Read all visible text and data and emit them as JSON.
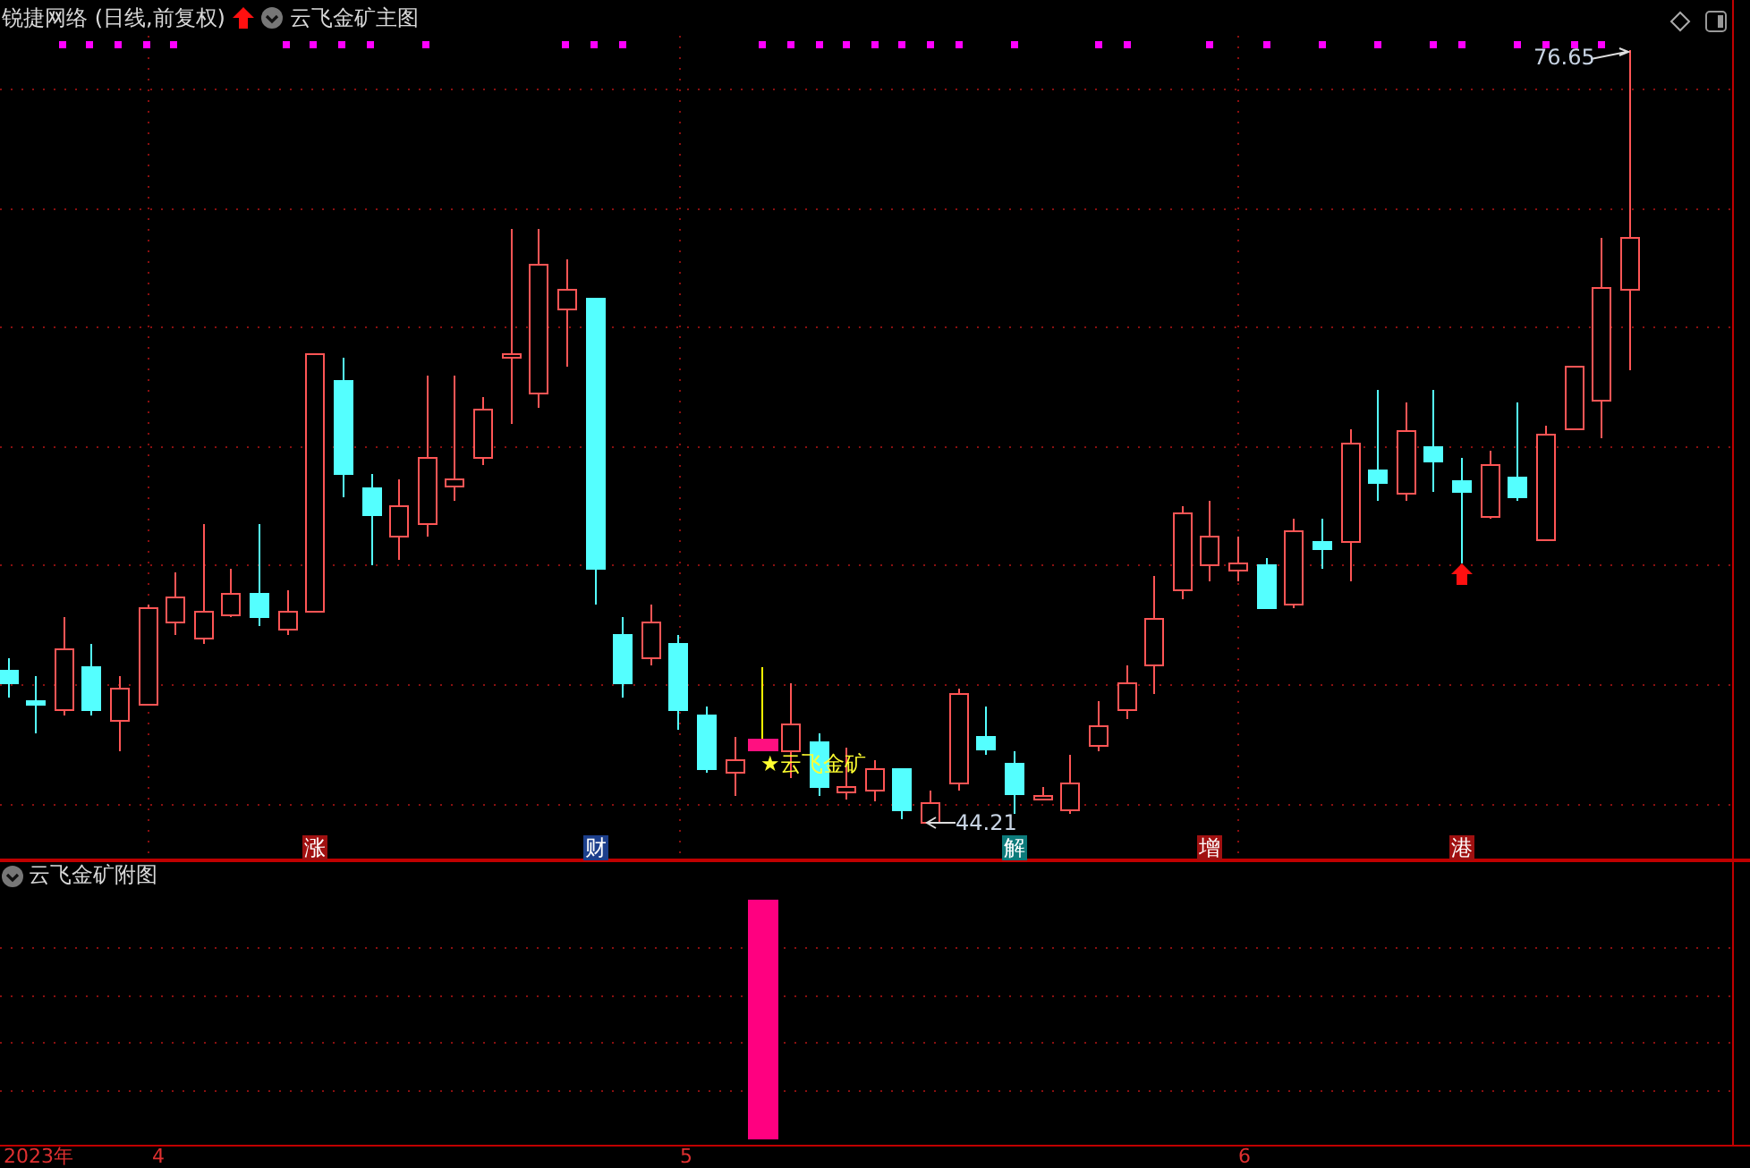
{
  "header": {
    "security": "锐捷网络 (日线,前复权)",
    "indicator": "云飞金矿主图"
  },
  "main_chart": {
    "high_label": "76.65",
    "low_label": "44.21",
    "signal_label": "★云飞金矿",
    "events": [
      {
        "label": "涨",
        "color": "#a01010"
      },
      {
        "label": "财",
        "color": "#1c3f8c"
      },
      {
        "label": "解",
        "color": "#0d7b7b"
      },
      {
        "label": "增",
        "color": "#a01010"
      },
      {
        "label": "港",
        "color": "#a01010"
      }
    ]
  },
  "sub_panel": {
    "title": "云飞金矿附图"
  },
  "time_axis": {
    "labels": [
      "2023年",
      "4",
      "5",
      "6"
    ]
  }
}
